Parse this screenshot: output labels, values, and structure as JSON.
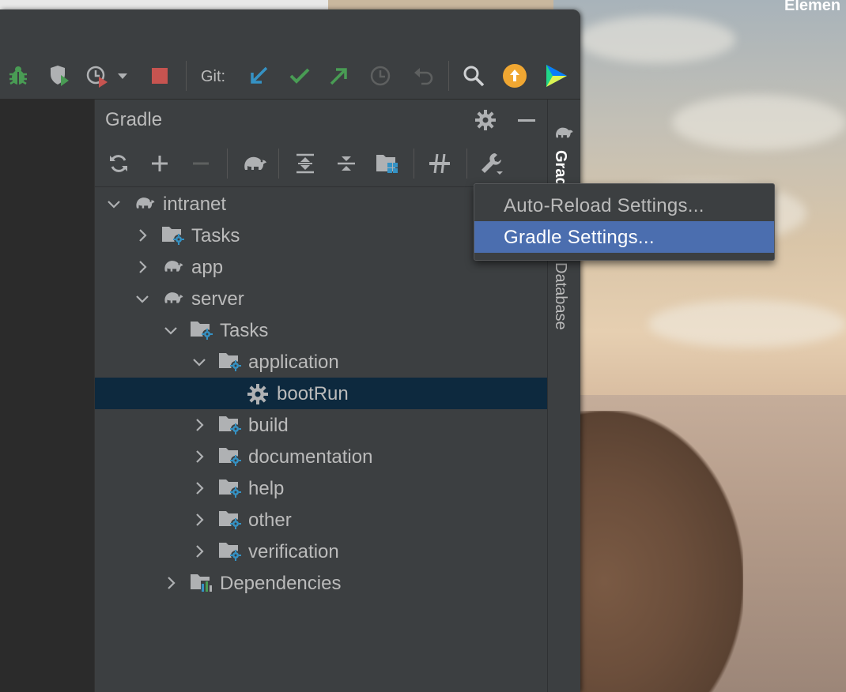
{
  "desktop": {
    "title_partial": "Elemen"
  },
  "toolbar": {
    "git_label": "Git:",
    "icons": [
      "debug-icon",
      "run-with-coverage-icon",
      "profiler-icon",
      "dropdown-arrow-icon",
      "stop-icon",
      "git-update-icon",
      "git-commit-icon",
      "git-push-icon",
      "git-history-icon",
      "git-rollback-icon",
      "search-icon",
      "ide-update-icon",
      "toolbox-icon"
    ],
    "colors": {
      "debug": "#499c54",
      "stop": "#c75450",
      "update": "#3592c4",
      "commit": "#499c54",
      "push": "#499c54",
      "upgrade": "#f0a732"
    }
  },
  "gradle_panel": {
    "title": "Gradle",
    "tools": [
      "reload-icon",
      "add-icon",
      "remove-icon",
      "execute-task-icon",
      "expand-all-icon",
      "collapse-all-icon",
      "group-modules-icon",
      "toggle-offline-icon",
      "build-tool-settings-icon"
    ],
    "tree": [
      {
        "label": "intranet",
        "level": 0,
        "expanded": true,
        "icon": "gradle-elephant-icon"
      },
      {
        "label": "Tasks",
        "level": 1,
        "expanded": false,
        "icon": "tasks-folder-icon"
      },
      {
        "label": "app",
        "level": 1,
        "expanded": false,
        "icon": "gradle-elephant-icon"
      },
      {
        "label": "server",
        "level": 1,
        "expanded": true,
        "icon": "gradle-elephant-icon"
      },
      {
        "label": "Tasks",
        "level": 2,
        "expanded": true,
        "icon": "tasks-folder-icon"
      },
      {
        "label": "application",
        "level": 3,
        "expanded": true,
        "icon": "tasks-folder-icon"
      },
      {
        "label": "bootRun",
        "level": 4,
        "selected": true,
        "icon": "gear-task-icon"
      },
      {
        "label": "build",
        "level": 3,
        "expanded": false,
        "icon": "tasks-folder-icon"
      },
      {
        "label": "documentation",
        "level": 3,
        "expanded": false,
        "icon": "tasks-folder-icon"
      },
      {
        "label": "help",
        "level": 3,
        "expanded": false,
        "icon": "tasks-folder-icon"
      },
      {
        "label": "other",
        "level": 3,
        "expanded": false,
        "icon": "tasks-folder-icon"
      },
      {
        "label": "verification",
        "level": 3,
        "expanded": false,
        "icon": "tasks-folder-icon"
      },
      {
        "label": "Dependencies",
        "level": 2,
        "expanded": false,
        "icon": "dependencies-icon"
      }
    ]
  },
  "right_strip": {
    "tabs": [
      {
        "label": "Gradle",
        "active": true
      },
      {
        "label": "Database",
        "active": false
      }
    ]
  },
  "popup_menu": {
    "items": [
      {
        "label": "Auto-Reload Settings...",
        "highlighted": false
      },
      {
        "label": "Gradle Settings...",
        "highlighted": true
      }
    ]
  }
}
